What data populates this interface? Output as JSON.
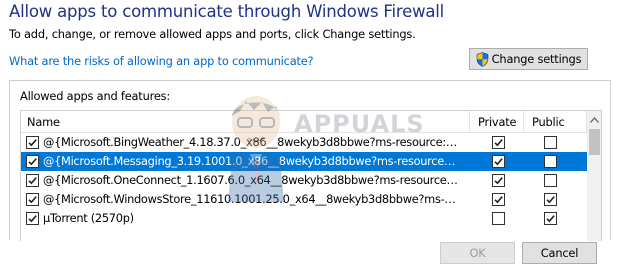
{
  "dialog": {
    "title": "Allow apps to communicate through Windows Firewall",
    "subtitle": "To add, change, or remove allowed apps and ports, click Change settings.",
    "risk_link": "What are the risks of allowing an app to communicate?",
    "change_settings_label": "Change settings"
  },
  "allowed": {
    "group_label": "Allowed apps and features:",
    "columns": {
      "name": "Name",
      "private": "Private",
      "public": "Public"
    },
    "rows": [
      {
        "name": "@{Microsoft.BingWeather_4.18.37.0_x86__8wekyb3d8bbwe?ms-resource://Mi...",
        "enabled": true,
        "private": true,
        "public": false,
        "selected": false
      },
      {
        "name": "@{Microsoft.Messaging_3.19.1001.0_x86__8wekyb3d8bbwe?ms-resource://Mi...",
        "enabled": true,
        "private": true,
        "public": false,
        "selected": true
      },
      {
        "name": "@{Microsoft.OneConnect_1.1607.6.0_x64__8wekyb3d8bbwe?ms-resource://Mi...",
        "enabled": true,
        "private": true,
        "public": false,
        "selected": false
      },
      {
        "name": "@{Microsoft.WindowsStore_11610.1001.25.0_x64__8wekyb3d8bbwe?ms-resou...",
        "enabled": true,
        "private": true,
        "public": true,
        "selected": false
      },
      {
        "name": "µTorrent (2570p)",
        "enabled": true,
        "private": false,
        "public": true,
        "selected": false
      }
    ]
  },
  "footer": {
    "ok_label": "OK",
    "cancel_label": "Cancel"
  },
  "watermark": {
    "text": "APPUALS"
  },
  "colors": {
    "title": "#1e3287",
    "link": "#0066cc",
    "selection": "#0078d7",
    "shield_blue": "#1d6fd8",
    "shield_yellow": "#f4c21b"
  },
  "icons": {
    "change_settings": "uac-shield-icon",
    "check": "checkmark-icon",
    "scroll_up": "scroll-up-arrow-icon"
  }
}
